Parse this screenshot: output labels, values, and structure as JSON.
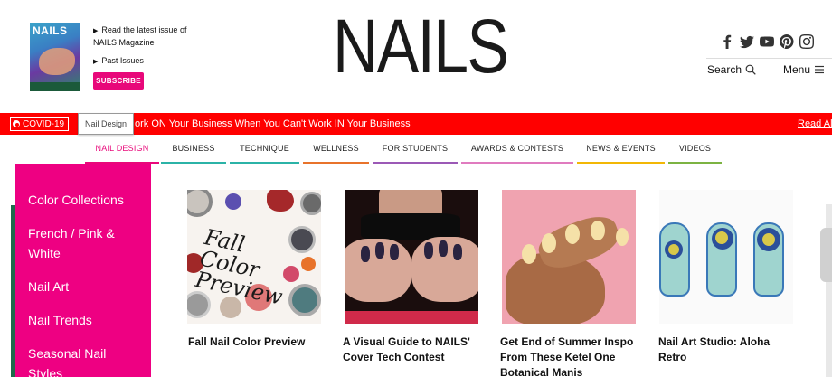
{
  "header": {
    "cover_title": "NAILS",
    "promo_read": "Read the latest issue of NAILS Magazine",
    "promo_read_line1": "Read the latest issue of",
    "promo_read_line2": "NAILS Magazine",
    "promo_past": "Past Issues",
    "subscribe_label": "SUBSCRIBE",
    "logo": "NAILS",
    "search_label": "Search",
    "menu_label": "Menu",
    "social": [
      "facebook-icon",
      "twitter-icon",
      "youtube-icon",
      "pinterest-icon",
      "instagram-icon"
    ]
  },
  "ticker": {
    "covid_label": "COVID-19",
    "tooltip": "Nail Design",
    "text": "ork ON Your Business When You Can't Work IN Your Business",
    "read_all": "Read All"
  },
  "nav": {
    "items": [
      {
        "label": "NAIL DESIGN",
        "color": "#e8087a"
      },
      {
        "label": "BUSINESS",
        "color": "#2bb3a7"
      },
      {
        "label": "TECHNIQUE",
        "color": "#2bb3a7"
      },
      {
        "label": "WELLNESS",
        "color": "#e8732b"
      },
      {
        "label": "FOR STUDENTS",
        "color": "#9b59b6"
      },
      {
        "label": "AWARDS & CONTESTS",
        "color": "#e07bbf"
      },
      {
        "label": "NEWS & EVENTS",
        "color": "#f2b705"
      },
      {
        "label": "VIDEOS",
        "color": "#7cb342"
      }
    ]
  },
  "mega_menu": {
    "items": [
      {
        "label": "Color Collections"
      },
      {
        "label": "French / Pink & White"
      },
      {
        "label": "Nail Art"
      },
      {
        "label": "Nail Trends"
      },
      {
        "label": "Seasonal Nail Styles"
      }
    ]
  },
  "cards": [
    {
      "title": "Fall Nail Color Preview",
      "image_text": "Fall Color Preview"
    },
    {
      "title": "A Visual Guide to NAILS' Cover Tech Contest"
    },
    {
      "title": "Get End of Summer Inspo From These Ketel One Botanical Manis"
    },
    {
      "title": "Nail Art Studio: Aloha Retro"
    }
  ],
  "colors": {
    "brand_pink": "#ee0082",
    "ticker_red": "#ff0000"
  }
}
